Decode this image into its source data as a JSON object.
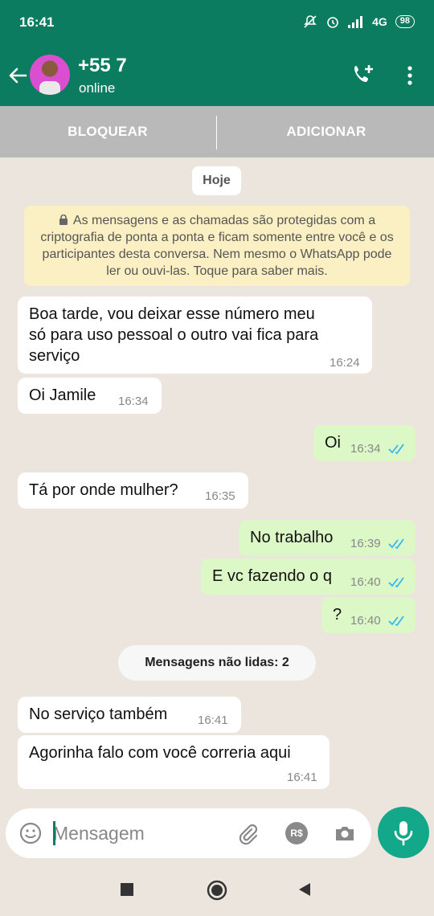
{
  "status": {
    "time": "16:41",
    "network": "4G",
    "battery": "98"
  },
  "header": {
    "contact_name": "+55 7",
    "contact_status": "online"
  },
  "actions": {
    "block_label": "BLOQUEAR",
    "add_label": "ADICIONAR"
  },
  "date_chip": "Hoje",
  "encryption_notice": "As mensagens e as chamadas são protegidas com a criptografia de ponta a ponta e ficam somente entre você e os participantes desta conversa. Nem mesmo o WhatsApp pode ler ou ouvi-las. Toque para saber mais.",
  "messages": [
    {
      "direction": "in",
      "text": "Boa tarde, vou deixar esse número meu\nsó para uso pessoal o outro vai fica para\nserviço",
      "time": "16:24"
    },
    {
      "direction": "in",
      "text": "Oi Jamile",
      "time": "16:34"
    },
    {
      "direction": "out",
      "text": "Oi",
      "time": "16:34"
    },
    {
      "direction": "in",
      "text": "Tá por onde mulher?",
      "time": "16:35"
    },
    {
      "direction": "out",
      "text": "No trabalho",
      "time": "16:39"
    },
    {
      "direction": "out",
      "text": "E vc fazendo o q",
      "time": "16:40"
    },
    {
      "direction": "out",
      "text": "?",
      "time": "16:40"
    },
    {
      "direction": "in",
      "text": "No serviço também",
      "time": "16:41"
    },
    {
      "direction": "in",
      "text": "Agorinha falo com você correria aqui",
      "time": "16:41"
    }
  ],
  "unread_label": "Mensagens não lidas: 2",
  "composer": {
    "placeholder": "Mensagem",
    "pay_label": "R$"
  },
  "colors": {
    "header": "#0B7C60",
    "outgoing": "#DCF8C6",
    "incoming": "#FFFFFF",
    "read_ticks": "#34B7F1",
    "mic": "#14A88A"
  }
}
